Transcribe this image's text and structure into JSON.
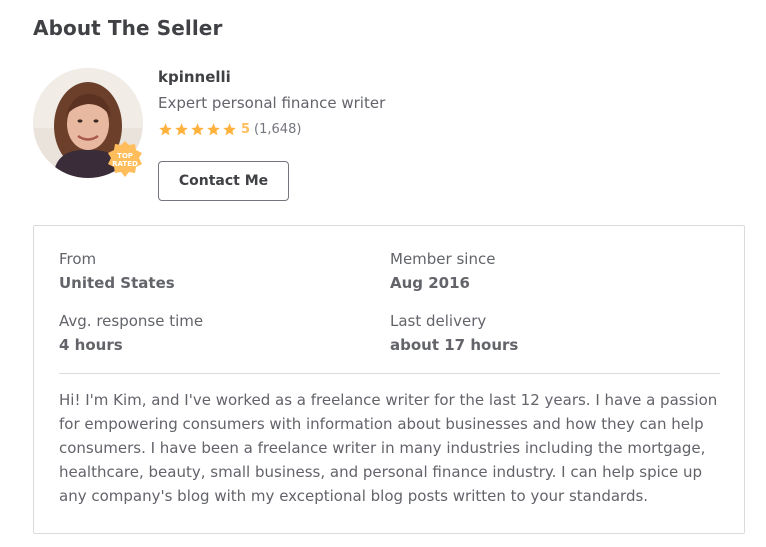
{
  "section": {
    "title": "About The Seller"
  },
  "seller": {
    "username": "kpinnelli",
    "tagline": "Expert personal finance writer",
    "badge": "TOP RATED",
    "rating": {
      "score": "5",
      "count": "(1,648)",
      "stars": 5
    },
    "contact_label": "Contact Me"
  },
  "stats": {
    "from": {
      "label": "From",
      "value": "United States"
    },
    "member_since": {
      "label": "Member since",
      "value": "Aug 2016"
    },
    "response_time": {
      "label": "Avg. response time",
      "value": "4 hours"
    },
    "last_delivery": {
      "label": "Last delivery",
      "value": "about 17 hours"
    }
  },
  "bio": "Hi! I'm Kim, and I've worked as a freelance writer for the last 12 years. I have a passion for empowering consumers with information about businesses and how they can help consumers. I have been a freelance writer in many industries including the mortgage, healthcare, beauty, small business, and personal finance industry. I can help spice up any company's blog with my exceptional blog posts written to your standards.",
  "colors": {
    "star": "#ffb33e",
    "badge": "#ffbe5b",
    "text": "#404145",
    "muted": "#62646a",
    "border": "#dadbdd"
  }
}
